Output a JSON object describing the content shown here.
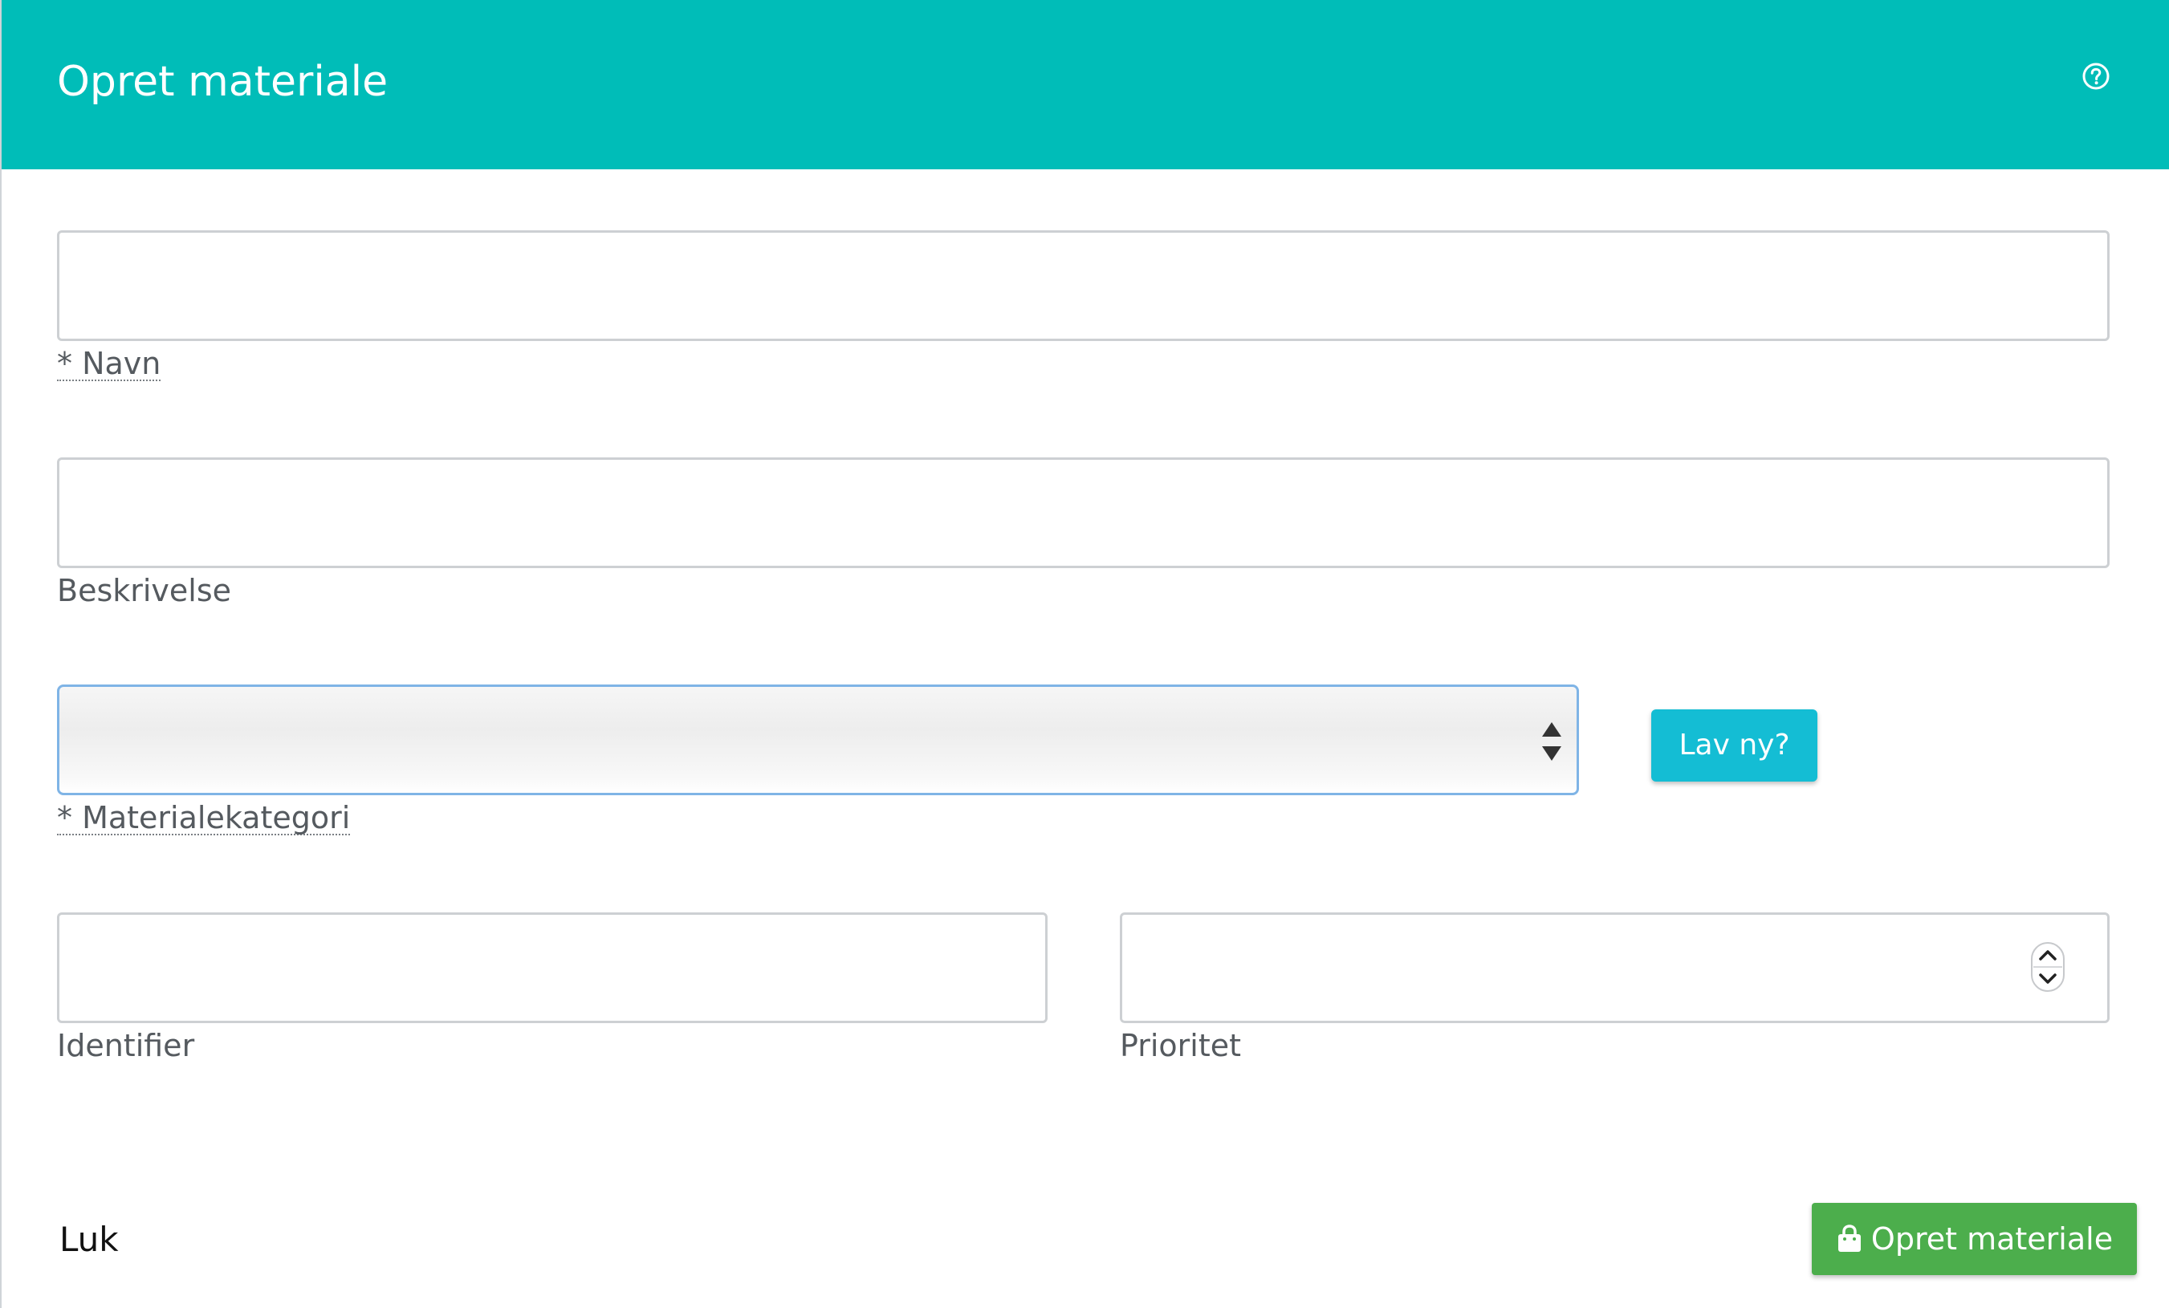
{
  "dialog": {
    "title": "Opret materiale",
    "help_icon": "question-circle-icon"
  },
  "form": {
    "name": {
      "label": "* Navn",
      "value": "",
      "placeholder": ""
    },
    "description": {
      "label": "Beskrivelse",
      "value": "",
      "placeholder": ""
    },
    "category": {
      "label": "* Materialekategori",
      "selected": ""
    },
    "new_category_button": "Lav ny?",
    "identifier": {
      "label": "Identifier",
      "value": "",
      "placeholder": ""
    },
    "priority": {
      "label": "Prioritet",
      "value": "",
      "placeholder": ""
    }
  },
  "footer": {
    "close_label": "Luk",
    "create_label": "Opret materiale",
    "create_icon": "shopping-bag-icon"
  },
  "colors": {
    "header": "#00bdb8",
    "new_button": "#14bdd4",
    "create_button": "#4cae4c",
    "select_focus_border": "#7fb4e6"
  }
}
